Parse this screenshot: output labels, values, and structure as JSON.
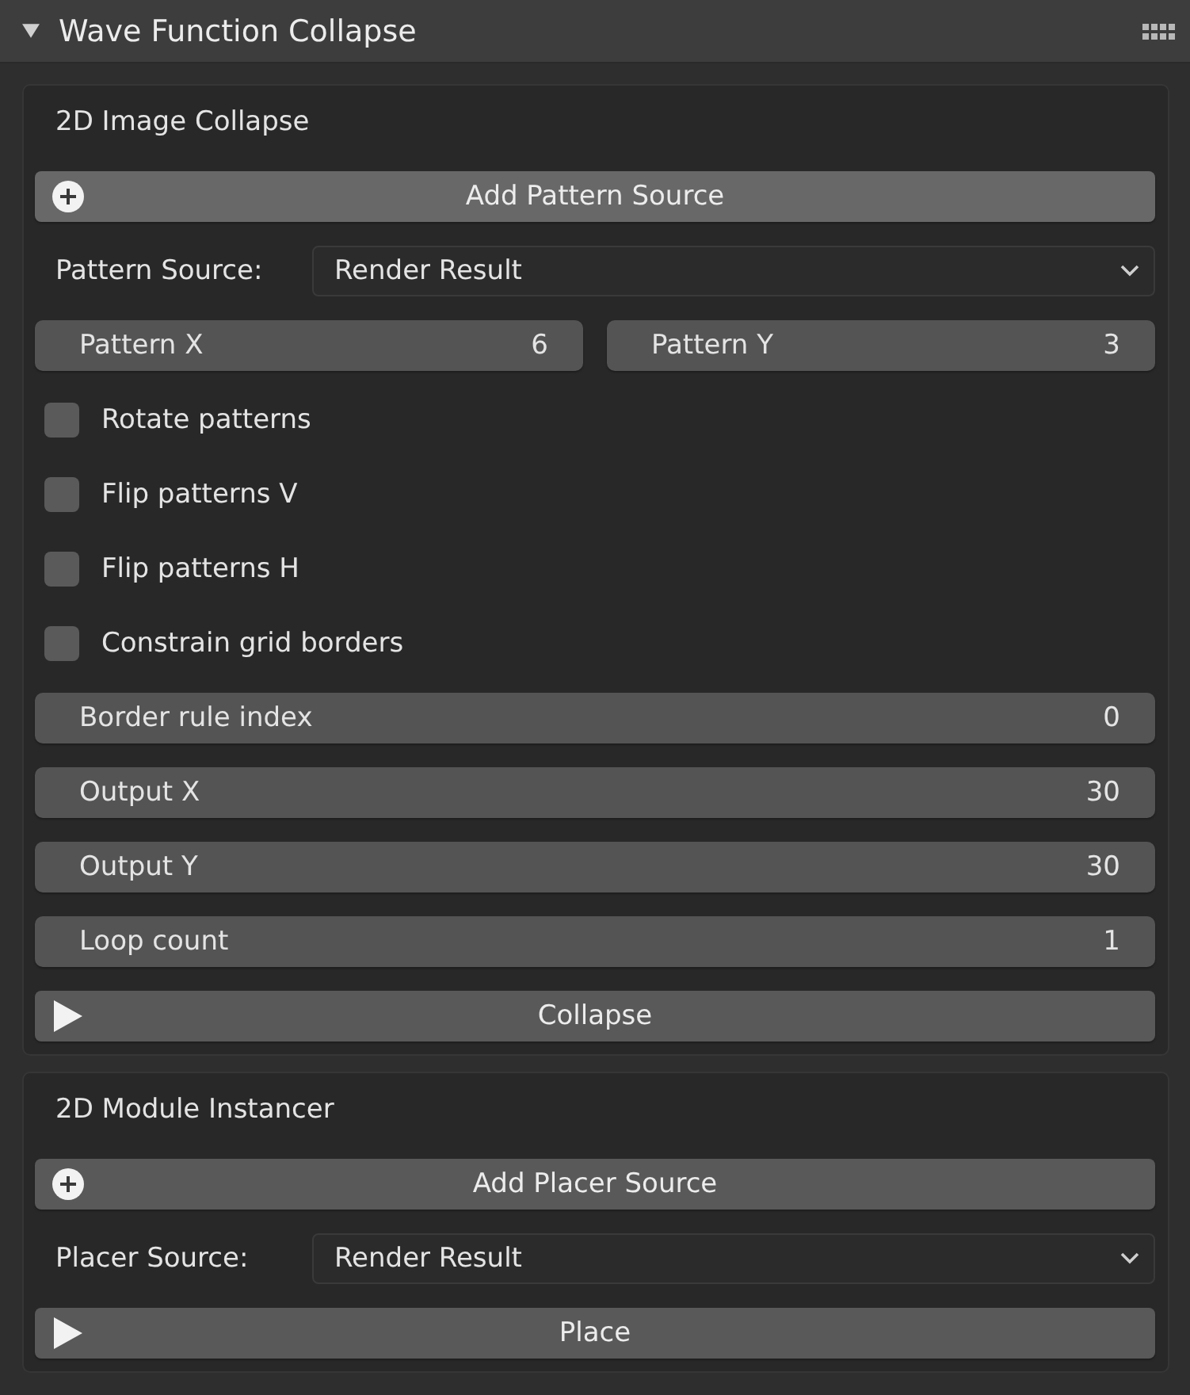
{
  "panel": {
    "title": "Wave Function Collapse",
    "expanded": true
  },
  "sections": [
    {
      "title": "2D Image Collapse",
      "items": [
        {
          "kind": "add",
          "label": "Add Pattern Source",
          "highlighted": true
        },
        {
          "kind": "dropdown",
          "label": "Pattern Source:",
          "value": "Render Result"
        },
        {
          "kind": "number_pair",
          "fields": [
            {
              "label": "Pattern X",
              "value": "6"
            },
            {
              "label": "Pattern Y",
              "value": "3"
            }
          ]
        },
        {
          "kind": "checkbox",
          "label": "Rotate patterns",
          "checked": false
        },
        {
          "kind": "checkbox",
          "label": "Flip patterns V",
          "checked": false
        },
        {
          "kind": "checkbox",
          "label": "Flip patterns H",
          "checked": false
        },
        {
          "kind": "checkbox",
          "label": "Constrain grid borders",
          "checked": false
        },
        {
          "kind": "number",
          "label": "Border rule index",
          "value": "0"
        },
        {
          "kind": "number",
          "label": "Output X",
          "value": "30"
        },
        {
          "kind": "number",
          "label": "Output Y",
          "value": "30"
        },
        {
          "kind": "number",
          "label": "Loop count",
          "value": "1"
        },
        {
          "kind": "run",
          "label": "Collapse",
          "highlighted": false
        }
      ]
    },
    {
      "title": "2D Module Instancer",
      "items": [
        {
          "kind": "add",
          "label": "Add Placer Source",
          "highlighted": false
        },
        {
          "kind": "dropdown",
          "label": "Placer Source:",
          "value": "Render Result"
        },
        {
          "kind": "run",
          "label": "Place",
          "highlighted": false
        }
      ]
    }
  ]
}
